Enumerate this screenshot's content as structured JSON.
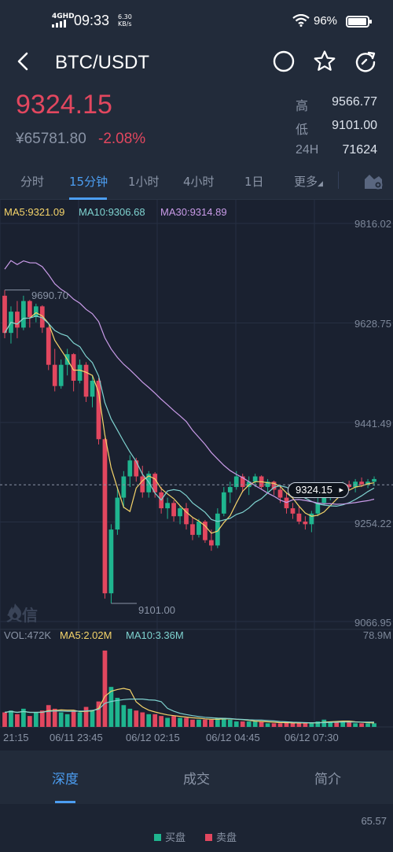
{
  "status_bar": {
    "network": "4GHD",
    "time": "09:33",
    "speed_value": "6.30",
    "speed_unit": "KB/s",
    "battery": "96%"
  },
  "header": {
    "pair": "BTC/USDT"
  },
  "ticker": {
    "last_price": "9324.15",
    "cny_price": "¥65781.80",
    "change": "-2.08%",
    "high_label": "高",
    "high_value": "9566.77",
    "low_label": "低",
    "low_value": "9101.00",
    "vol_label": "24H",
    "vol_value": "71624"
  },
  "interval_tabs": [
    "分时",
    "15分钟",
    "1小时",
    "4小时",
    "1日",
    "更多"
  ],
  "active_interval": "15分钟",
  "colors": {
    "up": "#1fb58f",
    "down": "#e2475f",
    "accent": "#4c9ef2",
    "ma5": "#f5d46a",
    "ma10": "#7fd3d0",
    "ma30": "#c99be8"
  },
  "chart_data": {
    "type": "candlestick",
    "ma_legend": {
      "ma5": "MA5:9321.09",
      "ma10": "MA10:9306.68",
      "ma30": "MA30:9314.89"
    },
    "y_ticks": [
      "9816.02",
      "9628.75",
      "9441.49",
      "9254.22",
      "9066.95"
    ],
    "y_range": [
      9066.95,
      9816.02
    ],
    "high_annotation": "9690.70",
    "low_annotation": "9101.00",
    "current_price": "9324.15",
    "x_ticks": [
      "21:15",
      "06/11 23:45",
      "06/12 02:15",
      "06/12 04:45",
      "06/12 07:30"
    ],
    "volume_legend": {
      "vol": "VOL:472K",
      "ma5": "MA5:2.02M",
      "ma10": "MA10:3.36M"
    },
    "volume_max": "78.9M",
    "candles": [
      [
        9680,
        9690.7,
        9600,
        9610
      ],
      [
        9610,
        9660,
        9590,
        9650
      ],
      [
        9650,
        9670,
        9600,
        9620
      ],
      [
        9620,
        9680,
        9615,
        9670
      ],
      [
        9670,
        9672,
        9620,
        9640
      ],
      [
        9640,
        9665,
        9630,
        9660
      ],
      [
        9660,
        9662,
        9610,
        9620
      ],
      [
        9620,
        9622,
        9540,
        9550
      ],
      [
        9550,
        9580,
        9500,
        9510
      ],
      [
        9510,
        9560,
        9505,
        9550
      ],
      [
        9550,
        9580,
        9530,
        9570
      ],
      [
        9570,
        9572,
        9500,
        9520
      ],
      [
        9520,
        9560,
        9515,
        9550
      ],
      [
        9550,
        9555,
        9480,
        9490
      ],
      [
        9490,
        9530,
        9470,
        9520
      ],
      [
        9520,
        9525,
        9400,
        9410
      ],
      [
        9410,
        9412,
        9110,
        9120
      ],
      [
        9120,
        9250,
        9101,
        9240
      ],
      [
        9240,
        9320,
        9230,
        9300
      ],
      [
        9300,
        9350,
        9280,
        9340
      ],
      [
        9340,
        9380,
        9320,
        9370
      ],
      [
        9370,
        9375,
        9330,
        9340
      ],
      [
        9340,
        9360,
        9300,
        9310
      ],
      [
        9310,
        9350,
        9300,
        9345
      ],
      [
        9345,
        9348,
        9300,
        9310
      ],
      [
        9310,
        9320,
        9270,
        9280
      ],
      [
        9280,
        9300,
        9260,
        9290
      ],
      [
        9290,
        9295,
        9255,
        9265
      ],
      [
        9265,
        9285,
        9250,
        9280
      ],
      [
        9280,
        9290,
        9240,
        9250
      ],
      [
        9250,
        9262,
        9220,
        9230
      ],
      [
        9230,
        9260,
        9225,
        9255
      ],
      [
        9255,
        9258,
        9215,
        9220
      ],
      [
        9220,
        9240,
        9200,
        9210
      ],
      [
        9210,
        9280,
        9205,
        9270
      ],
      [
        9270,
        9320,
        9265,
        9310
      ],
      [
        9310,
        9330,
        9290,
        9320
      ],
      [
        9320,
        9350,
        9315,
        9340
      ],
      [
        9340,
        9345,
        9310,
        9320
      ],
      [
        9320,
        9340,
        9305,
        9330
      ],
      [
        9330,
        9345,
        9320,
        9340
      ],
      [
        9340,
        9342,
        9315,
        9320
      ],
      [
        9320,
        9335,
        9310,
        9330
      ],
      [
        9330,
        9332,
        9305,
        9315
      ],
      [
        9315,
        9320,
        9290,
        9300
      ],
      [
        9300,
        9310,
        9270,
        9280
      ],
      [
        9280,
        9290,
        9260,
        9270
      ],
      [
        9270,
        9285,
        9250,
        9255
      ],
      [
        9255,
        9265,
        9240,
        9250
      ],
      [
        9250,
        9275,
        9235,
        9270
      ],
      [
        9270,
        9300,
        9265,
        9290
      ],
      [
        9290,
        9310,
        9285,
        9300
      ],
      [
        9300,
        9320,
        9295,
        9315
      ],
      [
        9315,
        9325,
        9300,
        9310
      ],
      [
        9310,
        9330,
        9305,
        9325
      ],
      [
        9325,
        9332,
        9315,
        9320
      ],
      [
        9320,
        9335,
        9310,
        9330
      ],
      [
        9330,
        9338,
        9320,
        9325
      ],
      [
        9325,
        9335,
        9318,
        9330
      ],
      [
        9330,
        9340,
        9322,
        9335
      ]
    ],
    "volumes": [
      8,
      9,
      7,
      10,
      6,
      8,
      9,
      12,
      10,
      8,
      7,
      9,
      8,
      11,
      9,
      14,
      42,
      22,
      16,
      12,
      10,
      9,
      8,
      7,
      7,
      6,
      5,
      6,
      5,
      5,
      4,
      4,
      4,
      4,
      5,
      5,
      4,
      3,
      3,
      3,
      3,
      3,
      2,
      2,
      2,
      3,
      2,
      2,
      2,
      2,
      3,
      4,
      3,
      3,
      3,
      3,
      2,
      2,
      2,
      2
    ]
  },
  "bottom_tabs": [
    "深度",
    "成交",
    "简介"
  ],
  "depth": {
    "value": "65.57",
    "buy_label": "买盘",
    "sell_label": "卖盘"
  },
  "watermark": "火信"
}
